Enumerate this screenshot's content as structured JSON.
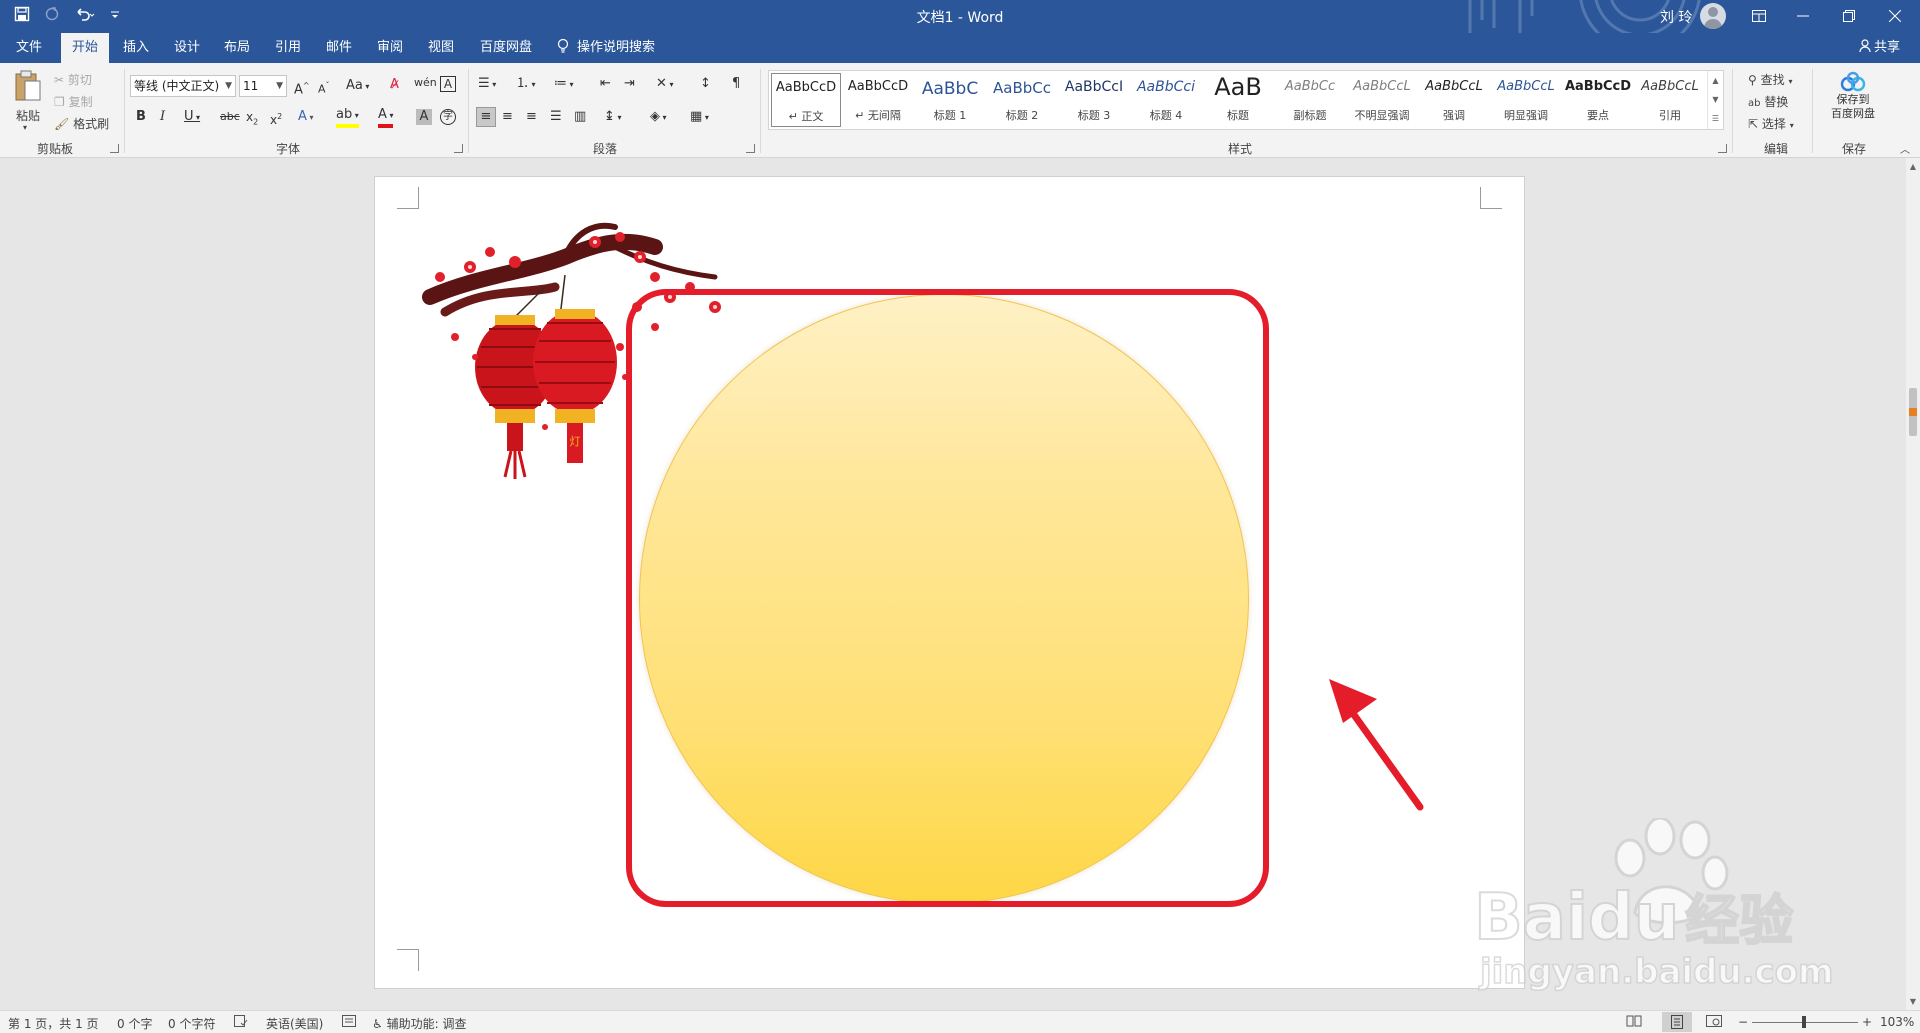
{
  "app": {
    "title": "文档1  -  Word",
    "user": "刘 玲",
    "accent": "#2b579a"
  },
  "tabs": [
    {
      "label": "文件",
      "active": false
    },
    {
      "label": "开始",
      "active": true
    },
    {
      "label": "插入",
      "active": false
    },
    {
      "label": "设计",
      "active": false
    },
    {
      "label": "布局",
      "active": false
    },
    {
      "label": "引用",
      "active": false
    },
    {
      "label": "邮件",
      "active": false
    },
    {
      "label": "审阅",
      "active": false
    },
    {
      "label": "视图",
      "active": false
    },
    {
      "label": "百度网盘",
      "active": false
    }
  ],
  "tell_me": "操作说明搜索",
  "share": "共享",
  "clipboard": {
    "paste": "粘贴",
    "cut": "剪切",
    "copy": "复制",
    "format_painter": "格式刷",
    "group": "剪贴板"
  },
  "font": {
    "name": "等线 (中文正文)",
    "size": "11",
    "group": "字体"
  },
  "paragraph": {
    "group": "段落"
  },
  "styles": {
    "group": "样式",
    "items": [
      {
        "sample": "AaBbCcD",
        "label": "正文",
        "selected": true
      },
      {
        "sample": "AaBbCcD",
        "label": "无间隔",
        "selected": false
      },
      {
        "sample": "AaBbC",
        "label": "标题 1",
        "selected": false
      },
      {
        "sample": "AaBbCc",
        "label": "标题 2",
        "selected": false
      },
      {
        "sample": "AaBbCcI",
        "label": "标题 3",
        "selected": false
      },
      {
        "sample": "AaBbCci",
        "label": "标题 4",
        "selected": false
      },
      {
        "sample": "AaB",
        "label": "标题",
        "selected": false
      },
      {
        "sample": "AaBbCc",
        "label": "副标题",
        "selected": false
      },
      {
        "sample": "AaBbCcL",
        "label": "不明显强调",
        "selected": false
      },
      {
        "sample": "AaBbCcL",
        "label": "强调",
        "selected": false
      },
      {
        "sample": "AaBbCcL",
        "label": "明显强调",
        "selected": false
      },
      {
        "sample": "AaBbCcD",
        "label": "要点",
        "selected": false
      },
      {
        "sample": "AaBbCcL",
        "label": "引用",
        "selected": false
      }
    ]
  },
  "editing": {
    "find": "查找",
    "replace": "替换",
    "select": "选择",
    "group": "编辑"
  },
  "save_pan": {
    "label_line1": "保存到",
    "label_line2": "百度网盘",
    "group": "保存"
  },
  "watermark": {
    "brand": "Baidu",
    "cn": "经验",
    "url": "jingyan.baidu.com"
  },
  "status": {
    "page": "第 1 页，共 1 页",
    "words": "0 个字",
    "chars": "0 个字符",
    "language": "英语(美国)",
    "accessibility": "辅助功能: 调查",
    "zoom": "103%"
  }
}
